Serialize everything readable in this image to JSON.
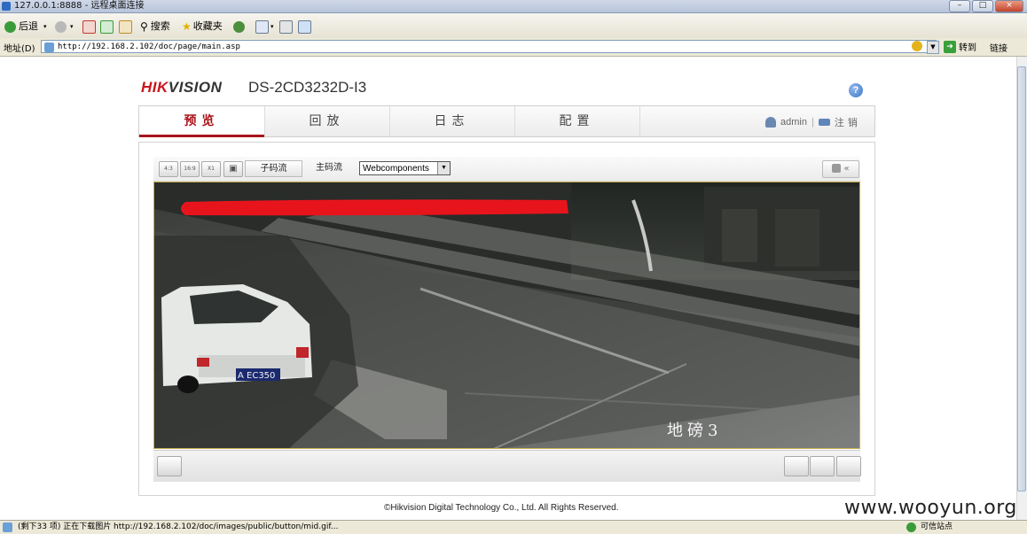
{
  "window": {
    "title": "127.0.0.1:8888 - 远程桌面连接"
  },
  "toolbar": {
    "back_label": "后退",
    "search_label": "搜索",
    "favorites_label": "收藏夹"
  },
  "address": {
    "label": "地址(D)",
    "url": "http://192.168.2.102/doc/page/main.asp",
    "go_label": "转到",
    "links_label": "链接"
  },
  "header": {
    "logo_red": "HIK",
    "logo_rest": "VISION",
    "model": "DS-2CD3232D-I3",
    "help_glyph": "?"
  },
  "nav": {
    "tabs": [
      {
        "label": "预览"
      },
      {
        "label": "回放"
      },
      {
        "label": "日志"
      },
      {
        "label": "配置"
      }
    ],
    "active_index": 0,
    "user": "admin",
    "separator": "|",
    "logout": "注销"
  },
  "preview": {
    "layout_buttons": [
      "4:3",
      "16:9",
      "X1",
      "▣"
    ],
    "sub_stream": "子码流",
    "main_stream": "主码流",
    "plugin_select": "Webcomponents",
    "ptz_collapse": "«",
    "osd_text": "地磅3",
    "plate_text": "A EC350"
  },
  "footer": {
    "copyright": "©Hikvision Digital Technology Co., Ltd. All Rights Reserved."
  },
  "status": {
    "text": "(剩下33 项) 正在下载图片 http://192.168.2.102/doc/images/public/button/mid.gif...",
    "zone": "可信站点"
  },
  "watermark": "www.wooyun.org",
  "colors": {
    "brand_red": "#c8161d",
    "active_tab": "#a8141b",
    "link_blue": "#2d6bc2"
  }
}
